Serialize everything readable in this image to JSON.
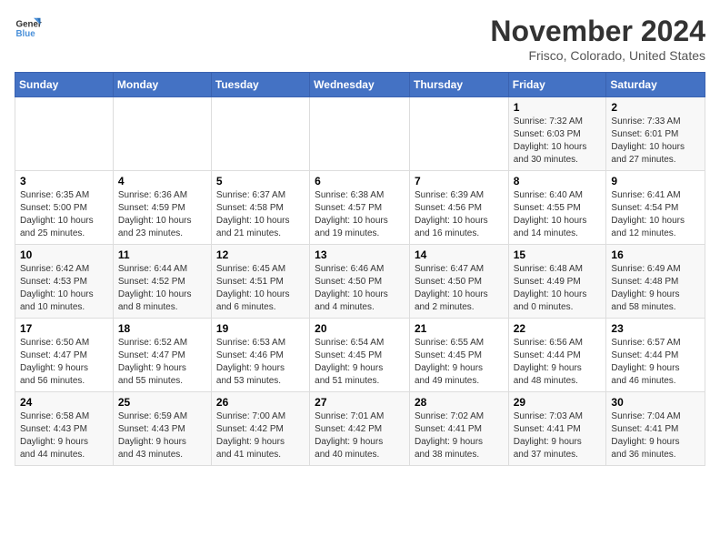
{
  "header": {
    "logo_line1": "General",
    "logo_line2": "Blue",
    "month": "November 2024",
    "location": "Frisco, Colorado, United States"
  },
  "weekdays": [
    "Sunday",
    "Monday",
    "Tuesday",
    "Wednesday",
    "Thursday",
    "Friday",
    "Saturday"
  ],
  "weeks": [
    [
      {
        "day": "",
        "detail": ""
      },
      {
        "day": "",
        "detail": ""
      },
      {
        "day": "",
        "detail": ""
      },
      {
        "day": "",
        "detail": ""
      },
      {
        "day": "",
        "detail": ""
      },
      {
        "day": "1",
        "detail": "Sunrise: 7:32 AM\nSunset: 6:03 PM\nDaylight: 10 hours\nand 30 minutes."
      },
      {
        "day": "2",
        "detail": "Sunrise: 7:33 AM\nSunset: 6:01 PM\nDaylight: 10 hours\nand 27 minutes."
      }
    ],
    [
      {
        "day": "3",
        "detail": "Sunrise: 6:35 AM\nSunset: 5:00 PM\nDaylight: 10 hours\nand 25 minutes."
      },
      {
        "day": "4",
        "detail": "Sunrise: 6:36 AM\nSunset: 4:59 PM\nDaylight: 10 hours\nand 23 minutes."
      },
      {
        "day": "5",
        "detail": "Sunrise: 6:37 AM\nSunset: 4:58 PM\nDaylight: 10 hours\nand 21 minutes."
      },
      {
        "day": "6",
        "detail": "Sunrise: 6:38 AM\nSunset: 4:57 PM\nDaylight: 10 hours\nand 19 minutes."
      },
      {
        "day": "7",
        "detail": "Sunrise: 6:39 AM\nSunset: 4:56 PM\nDaylight: 10 hours\nand 16 minutes."
      },
      {
        "day": "8",
        "detail": "Sunrise: 6:40 AM\nSunset: 4:55 PM\nDaylight: 10 hours\nand 14 minutes."
      },
      {
        "day": "9",
        "detail": "Sunrise: 6:41 AM\nSunset: 4:54 PM\nDaylight: 10 hours\nand 12 minutes."
      }
    ],
    [
      {
        "day": "10",
        "detail": "Sunrise: 6:42 AM\nSunset: 4:53 PM\nDaylight: 10 hours\nand 10 minutes."
      },
      {
        "day": "11",
        "detail": "Sunrise: 6:44 AM\nSunset: 4:52 PM\nDaylight: 10 hours\nand 8 minutes."
      },
      {
        "day": "12",
        "detail": "Sunrise: 6:45 AM\nSunset: 4:51 PM\nDaylight: 10 hours\nand 6 minutes."
      },
      {
        "day": "13",
        "detail": "Sunrise: 6:46 AM\nSunset: 4:50 PM\nDaylight: 10 hours\nand 4 minutes."
      },
      {
        "day": "14",
        "detail": "Sunrise: 6:47 AM\nSunset: 4:50 PM\nDaylight: 10 hours\nand 2 minutes."
      },
      {
        "day": "15",
        "detail": "Sunrise: 6:48 AM\nSunset: 4:49 PM\nDaylight: 10 hours\nand 0 minutes."
      },
      {
        "day": "16",
        "detail": "Sunrise: 6:49 AM\nSunset: 4:48 PM\nDaylight: 9 hours\nand 58 minutes."
      }
    ],
    [
      {
        "day": "17",
        "detail": "Sunrise: 6:50 AM\nSunset: 4:47 PM\nDaylight: 9 hours\nand 56 minutes."
      },
      {
        "day": "18",
        "detail": "Sunrise: 6:52 AM\nSunset: 4:47 PM\nDaylight: 9 hours\nand 55 minutes."
      },
      {
        "day": "19",
        "detail": "Sunrise: 6:53 AM\nSunset: 4:46 PM\nDaylight: 9 hours\nand 53 minutes."
      },
      {
        "day": "20",
        "detail": "Sunrise: 6:54 AM\nSunset: 4:45 PM\nDaylight: 9 hours\nand 51 minutes."
      },
      {
        "day": "21",
        "detail": "Sunrise: 6:55 AM\nSunset: 4:45 PM\nDaylight: 9 hours\nand 49 minutes."
      },
      {
        "day": "22",
        "detail": "Sunrise: 6:56 AM\nSunset: 4:44 PM\nDaylight: 9 hours\nand 48 minutes."
      },
      {
        "day": "23",
        "detail": "Sunrise: 6:57 AM\nSunset: 4:44 PM\nDaylight: 9 hours\nand 46 minutes."
      }
    ],
    [
      {
        "day": "24",
        "detail": "Sunrise: 6:58 AM\nSunset: 4:43 PM\nDaylight: 9 hours\nand 44 minutes."
      },
      {
        "day": "25",
        "detail": "Sunrise: 6:59 AM\nSunset: 4:43 PM\nDaylight: 9 hours\nand 43 minutes."
      },
      {
        "day": "26",
        "detail": "Sunrise: 7:00 AM\nSunset: 4:42 PM\nDaylight: 9 hours\nand 41 minutes."
      },
      {
        "day": "27",
        "detail": "Sunrise: 7:01 AM\nSunset: 4:42 PM\nDaylight: 9 hours\nand 40 minutes."
      },
      {
        "day": "28",
        "detail": "Sunrise: 7:02 AM\nSunset: 4:41 PM\nDaylight: 9 hours\nand 38 minutes."
      },
      {
        "day": "29",
        "detail": "Sunrise: 7:03 AM\nSunset: 4:41 PM\nDaylight: 9 hours\nand 37 minutes."
      },
      {
        "day": "30",
        "detail": "Sunrise: 7:04 AM\nSunset: 4:41 PM\nDaylight: 9 hours\nand 36 minutes."
      }
    ]
  ]
}
